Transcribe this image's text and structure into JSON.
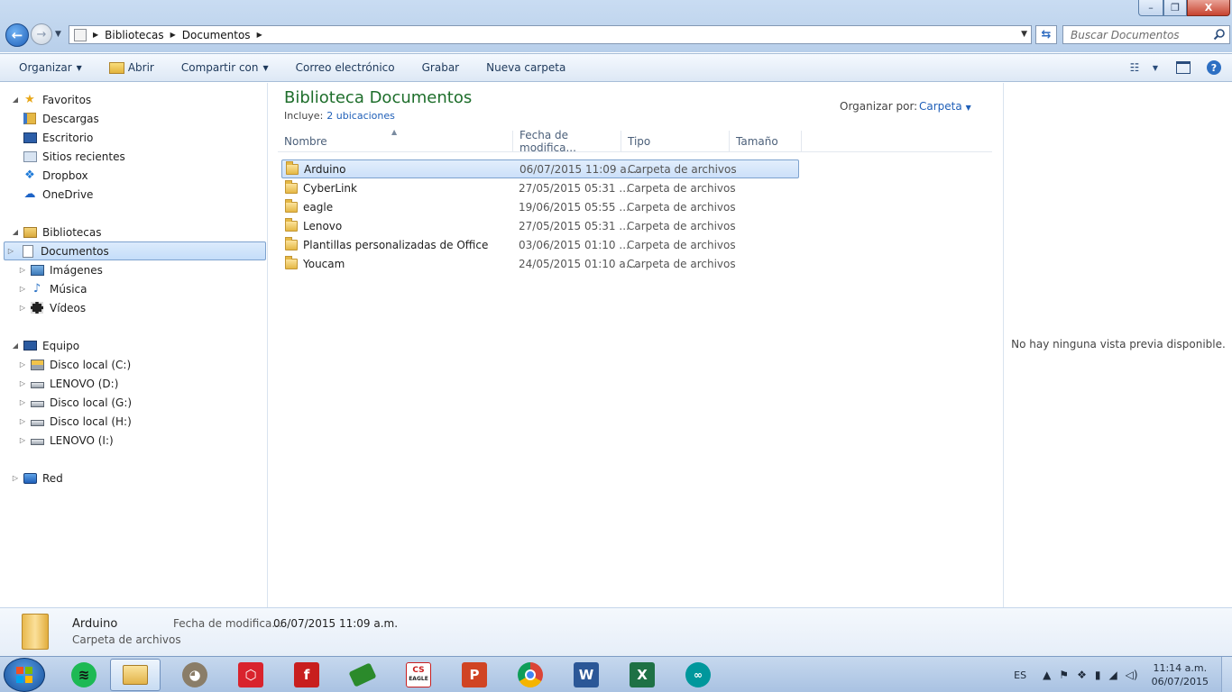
{
  "window": {
    "minimize": "–",
    "maximize": "❐",
    "close": "X"
  },
  "address": {
    "breadcrumbs": [
      "Bibliotecas",
      "Documentos"
    ],
    "search_placeholder": "Buscar Documentos"
  },
  "commands": {
    "organizar": "Organizar",
    "abrir": "Abrir",
    "compartir": "Compartir con",
    "correo": "Correo electrónico",
    "grabar": "Grabar",
    "nueva_carpeta": "Nueva carpeta"
  },
  "nav": {
    "favoritos": {
      "label": "Favoritos",
      "items": [
        "Descargas",
        "Escritorio",
        "Sitios recientes",
        "Dropbox",
        "OneDrive"
      ]
    },
    "bibliotecas": {
      "label": "Bibliotecas",
      "items": [
        "Documentos",
        "Imágenes",
        "Música",
        "Vídeos"
      ]
    },
    "equipo": {
      "label": "Equipo",
      "items": [
        "Disco local (C:)",
        "LENOVO (D:)",
        "Disco local (G:)",
        "Disco local (H:)",
        "LENOVO (I:)"
      ]
    },
    "red": {
      "label": "Red"
    }
  },
  "library": {
    "title": "Biblioteca Documentos",
    "includes_label": "Incluye:",
    "includes_link": "2 ubicaciones",
    "arrange_label": "Organizar por:",
    "arrange_value": "Carpeta"
  },
  "columns": [
    "Nombre",
    "Fecha de modifica...",
    "Tipo",
    "Tamaño"
  ],
  "files": [
    {
      "name": "Arduino",
      "date": "06/07/2015 11:09 a....",
      "type": "Carpeta de archivos"
    },
    {
      "name": "CyberLink",
      "date": "27/05/2015 05:31 ...",
      "type": "Carpeta de archivos"
    },
    {
      "name": "eagle",
      "date": "19/06/2015 05:55 ...",
      "type": "Carpeta de archivos"
    },
    {
      "name": "Lenovo",
      "date": "27/05/2015 05:31 ...",
      "type": "Carpeta de archivos"
    },
    {
      "name": "Plantillas personalizadas de Office",
      "date": "03/06/2015 01:10 ...",
      "type": "Carpeta de archivos"
    },
    {
      "name": "Youcam",
      "date": "24/05/2015 01:10 a....",
      "type": "Carpeta de archivos"
    }
  ],
  "preview": {
    "message": "No hay ninguna vista previa disponible."
  },
  "details": {
    "name": "Arduino",
    "type": "Carpeta de archivos",
    "date_label": "Fecha de modifica...",
    "date_value": "06/07/2015 11:09 a.m."
  },
  "taskbar": {
    "apps": [
      "spotify",
      "explorer",
      "gimp",
      "sketchup",
      "fritzing",
      "pcb",
      "eagle",
      "powerpoint",
      "chrome",
      "word",
      "excel",
      "arduino"
    ],
    "eagle_text_top": "CS",
    "eagle_text_bottom": "EAGLE",
    "lang": "ES",
    "time": "11:14 a.m.",
    "date": "06/07/2015"
  },
  "colors": {
    "library_title": "#1e6e2b",
    "link": "#1f5fb8",
    "selection": "#cce0f9"
  }
}
